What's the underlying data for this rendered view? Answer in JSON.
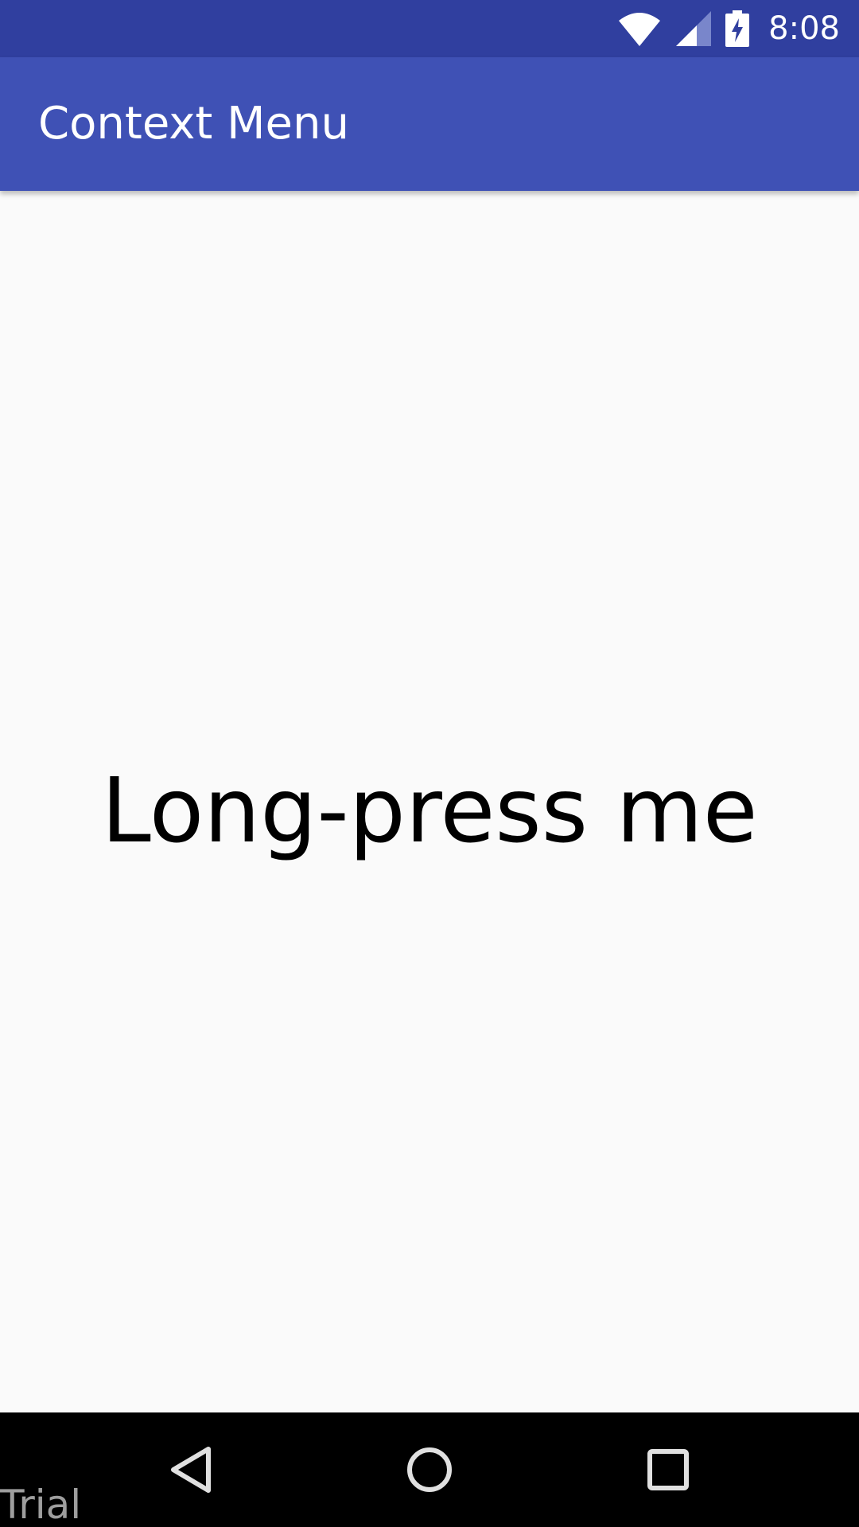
{
  "status_bar": {
    "time": "8:08",
    "icons": [
      "wifi-icon",
      "cell-signal-icon",
      "battery-charging-icon"
    ],
    "color": "#303f9f"
  },
  "app_bar": {
    "title": "Context Menu",
    "color": "#3f51b5"
  },
  "content": {
    "label": "Long-press me"
  },
  "nav_bar": {
    "buttons": [
      "back-icon",
      "home-icon",
      "recents-icon"
    ],
    "watermark": "Trial"
  }
}
